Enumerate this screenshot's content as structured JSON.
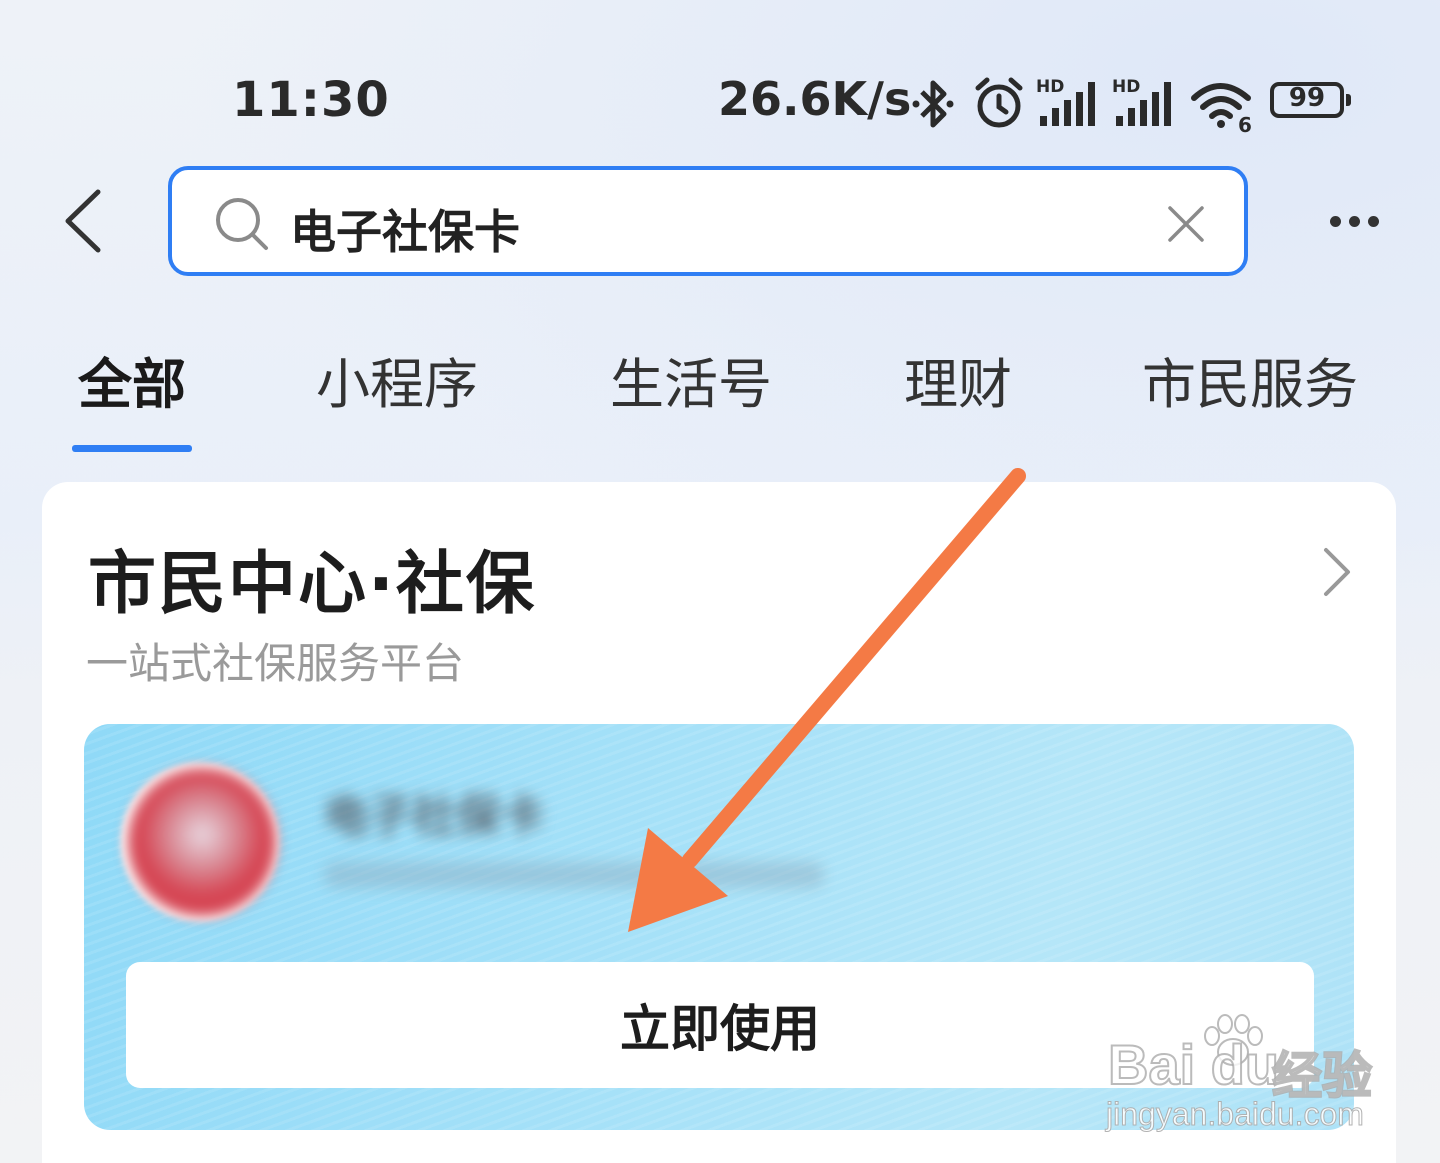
{
  "status_bar": {
    "time": "11:30",
    "net_speed": "26.6K/s",
    "battery": "99",
    "icons": [
      "bluetooth-icon",
      "alarm-icon",
      "signal-hd-icon",
      "signal-hd-icon",
      "wifi6-icon",
      "battery-icon"
    ]
  },
  "search": {
    "query": "电子社保卡"
  },
  "tabs": [
    {
      "label": "全部",
      "active": true
    },
    {
      "label": "小程序"
    },
    {
      "label": "生活号"
    },
    {
      "label": "理财"
    },
    {
      "label": "市民服务"
    }
  ],
  "result_card": {
    "title": "市民中心·社保",
    "subtitle": "一站式社保服务平台",
    "service": {
      "title": "电子社保卡",
      "button_label": "立即使用"
    }
  },
  "watermark": {
    "brand": "Bai du",
    "text": "经验",
    "url": "jingyan.baidu.com"
  },
  "colors": {
    "accent": "#2f7ef4",
    "arrow": "#f47a45",
    "card_blue": "#a6e1f8"
  }
}
